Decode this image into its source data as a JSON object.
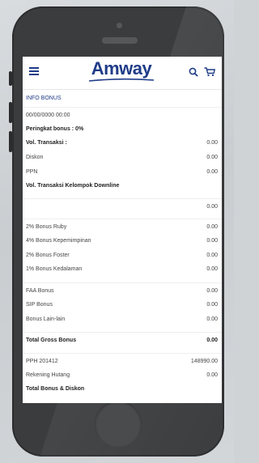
{
  "header": {
    "logo_text": "Amway",
    "menu_icon": "hamburger-icon",
    "search_icon": "search-icon",
    "cart_icon": "cart-icon"
  },
  "section_title": "INFO BONUS",
  "rows": [
    {
      "label": "00/00/0000 00:00",
      "value": ""
    },
    {
      "label": "Peringkat bonus : 0%",
      "value": ""
    },
    {
      "label": "Vol. Transaksi :",
      "value": "0.00"
    },
    {
      "label": "Diskon",
      "value": "0.00"
    },
    {
      "label": "PPN",
      "value": "0.00"
    },
    {
      "label": "Vol. Transaksi Kelompok Downline",
      "value": ""
    },
    {
      "label": "",
      "value": "0.00"
    },
    {
      "label": "2% Bonus Ruby",
      "value": "0.00"
    },
    {
      "label": "4% Bonus Kepemimpinan",
      "value": "0.00"
    },
    {
      "label": "2% Bonus Foster",
      "value": "0.00"
    },
    {
      "label": "1% Bonus Kedalaman",
      "value": "0.00"
    },
    {
      "label": "FAA Bonus",
      "value": "0.00"
    },
    {
      "label": "SIP Bonus",
      "value": "0.00"
    },
    {
      "label": "Bonus Lain-lain",
      "value": "0.00"
    },
    {
      "label": "Total Gross Bonus",
      "value": "0.00"
    },
    {
      "label": "PPH 201412",
      "value": "148990.00"
    },
    {
      "label": "Rekening Hutang",
      "value": "0.00"
    },
    {
      "label": "Total Bonus & Diskon",
      "value": ""
    }
  ],
  "colors": {
    "brand": "#1f3c88",
    "phone_body": "#3b3c3e"
  }
}
